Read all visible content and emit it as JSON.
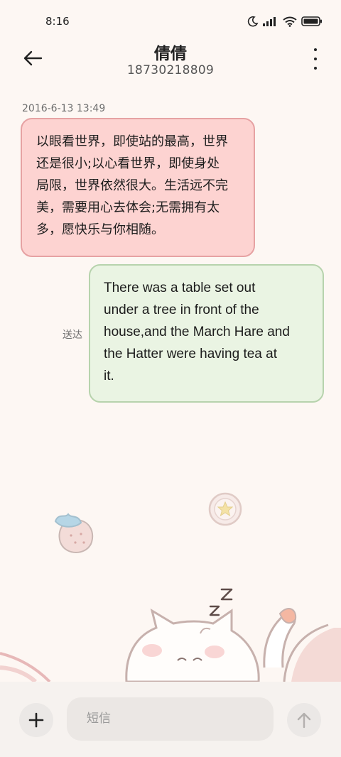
{
  "status_bar": {
    "time": "8:16",
    "icons": [
      "moon-icon",
      "signal-icon",
      "wifi-icon",
      "battery-icon"
    ]
  },
  "header": {
    "contact_name": "倩倩",
    "phone_number": "18730218809",
    "back_icon": "arrow-left-icon",
    "menu_icon": "more-vertical-icon"
  },
  "conversation": {
    "timestamp": "2016-6-13 13:49",
    "messages": [
      {
        "direction": "incoming",
        "lines": [
          "以眼看世界，即使站的最高，世界",
          "还是很小;以心看世界，即使身处",
          "局限，世界依然很大。生活远不完",
          "美，需要用心去体会;无需拥有太",
          "多，愿快乐与你相随。"
        ]
      },
      {
        "direction": "outgoing",
        "status": "送达",
        "lines": [
          "There was a table set out",
          "under a tree in front of the",
          "house,and the March Hare and",
          "the Hatter were having tea at",
          "it."
        ]
      }
    ]
  },
  "composer": {
    "placeholder": "短信",
    "add_icon": "plus-icon",
    "send_icon": "arrow-up-icon"
  },
  "colors": {
    "background": "#fdf7f3",
    "incoming_bubble": "#fdd3d1",
    "incoming_border": "#e6a2a3",
    "outgoing_bubble": "#eaf4e3",
    "outgoing_border": "#b7d3ad"
  }
}
